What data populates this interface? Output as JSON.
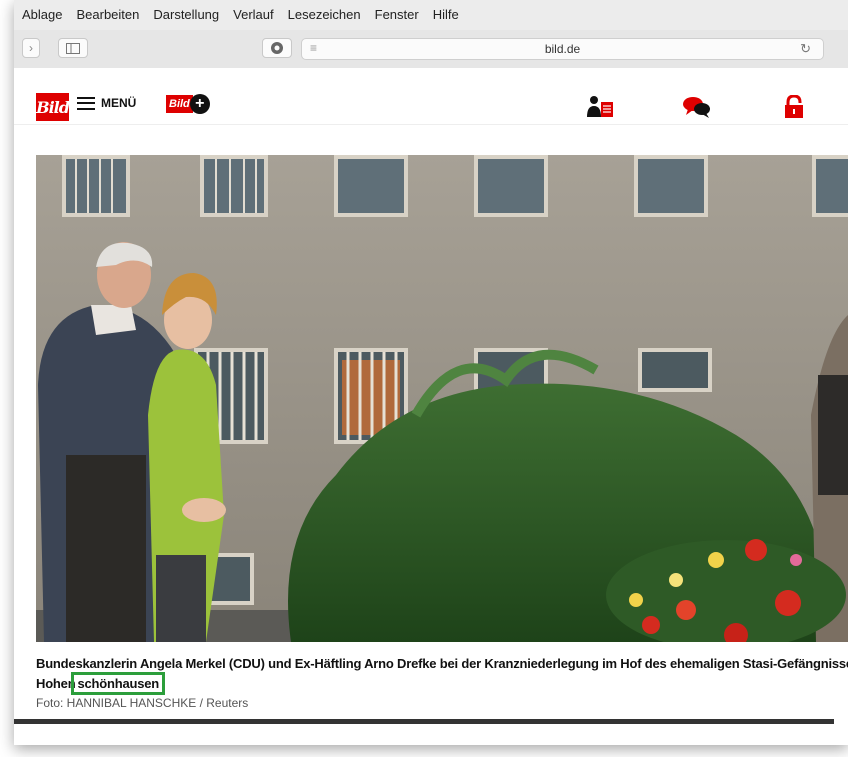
{
  "menubar": {
    "items": [
      "Ablage",
      "Bearbeiten",
      "Darstellung",
      "Verlauf",
      "Lesezeichen",
      "Fenster",
      "Hilfe"
    ]
  },
  "toolbar": {
    "url": "bild.de"
  },
  "header": {
    "logo_text": "Bild",
    "menu_label": "MENÜ",
    "bildplus_text": "Bild",
    "bildplus_plus": "+"
  },
  "colors": {
    "brand_red": "#de0000",
    "highlight_green": "#2c9e3b"
  },
  "article": {
    "caption_main": "Bundeskanzlerin Angela Merkel (CDU) und Ex-Häftling Arno Drefke bei der Kranzniederlegung im Hof des ehemaligen Stasi-Gefängnisses in B",
    "caption_prefix": "Hohen",
    "caption_highlight": "schönhausen",
    "photo_credit": "Foto: HANNIBAL HANSCHKE / Reuters"
  },
  "icons": [
    "back-icon",
    "sidebar-icon",
    "share-icon",
    "reader-icon",
    "reload-icon",
    "account-icon",
    "comments-icon",
    "lock-icon"
  ]
}
